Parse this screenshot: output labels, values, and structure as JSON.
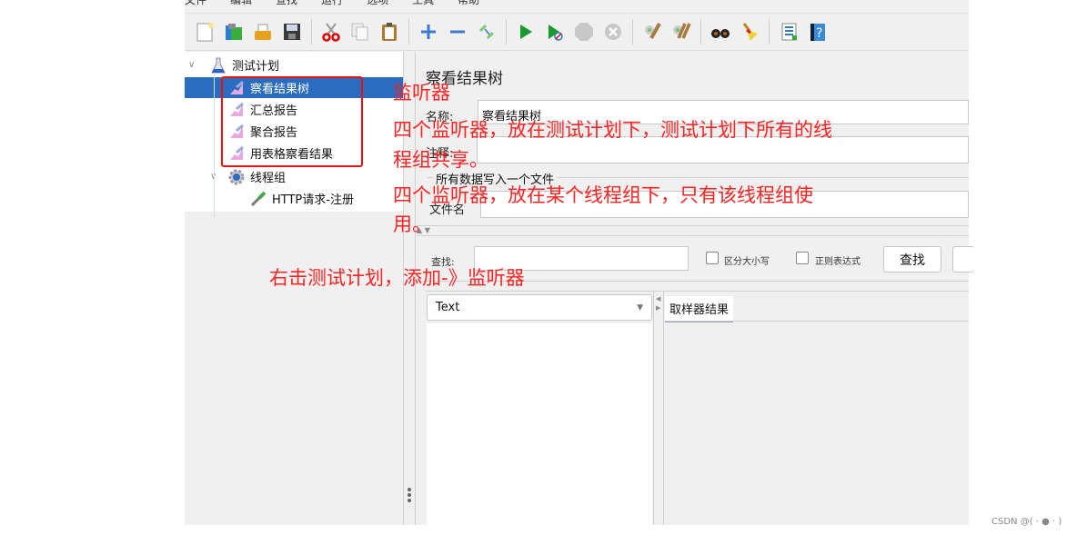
{
  "menubar": {
    "items": [
      "文件",
      "编辑",
      "查找",
      "运行",
      "选项",
      "工具",
      "帮助"
    ]
  },
  "toolbar": {
    "buttons": [
      "new-icon",
      "templates-icon",
      "open-icon",
      "save-icon",
      "cut-icon",
      "copy-icon",
      "paste-icon",
      "expand-icon",
      "collapse-icon",
      "toggle-icon",
      "start-icon",
      "start-no-pauses-icon",
      "stop-icon",
      "shutdown-icon",
      "clear-icon",
      "clear-all-icon",
      "search-icon",
      "reset-search-icon",
      "function-helper-icon",
      "help-icon"
    ]
  },
  "tree": {
    "root": "测试计划",
    "listeners": [
      "察看结果树",
      "汇总报告",
      "聚合报告",
      "用表格察看结果"
    ],
    "thread_group": "线程组",
    "sampler": "HTTP请求-注册",
    "selected": "察看结果树"
  },
  "panel": {
    "title": "察看结果树",
    "name_label": "名称:",
    "name_value": "察看结果树",
    "comment_label": "注释:",
    "comment_value": "",
    "file_section": "所有数据写入一个文件",
    "filename_label": "文件名",
    "filename_value": "",
    "search_label": "查找:",
    "search_value": "",
    "case_sensitive": "区分大小写",
    "regex": "正则表达式",
    "search_button": "查找",
    "renderer_select": "Text",
    "result_tab": "取样器结果"
  },
  "annotations": {
    "title": "监听器",
    "line1a": "四个监听器，放在测试计划下，测试计划下所有的线",
    "line1b": "程组共享。",
    "line2a": "四个监听器，放在某个线程组下，只有该线程组使",
    "line2b": "用。",
    "howto": "右击测试计划，添加-》监听器"
  },
  "watermark": "CSDN @( · ● · )",
  "colors": {
    "selection": "#2a6cbf",
    "annotation": "#ff2222"
  }
}
